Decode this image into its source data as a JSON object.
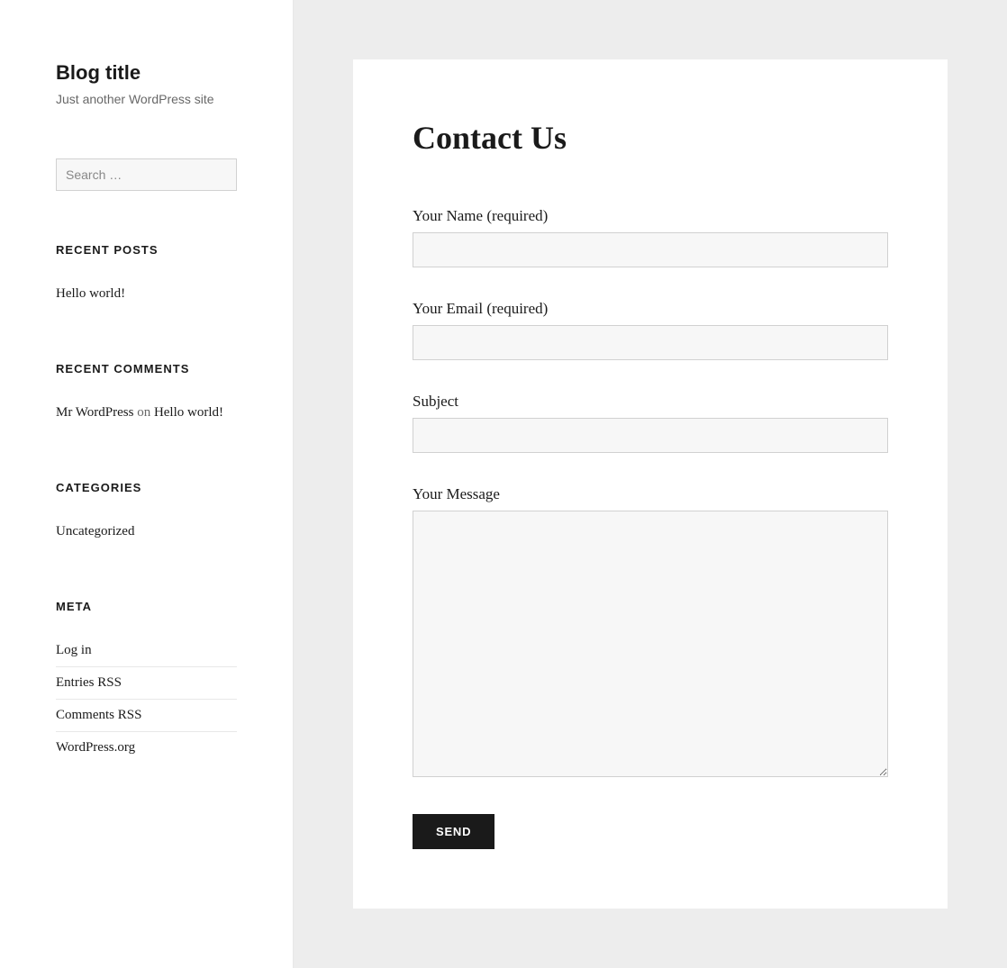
{
  "sidebar": {
    "site_title": "Blog title",
    "tagline": "Just another WordPress site",
    "search": {
      "placeholder": "Search …"
    },
    "recent_posts": {
      "heading": "RECENT POSTS",
      "items": [
        "Hello world!"
      ]
    },
    "recent_comments": {
      "heading": "RECENT COMMENTS",
      "items": [
        {
          "author": "Mr WordPress",
          "connector": " on ",
          "post": "Hello world!"
        }
      ]
    },
    "categories": {
      "heading": "CATEGORIES",
      "items": [
        "Uncategorized"
      ]
    },
    "meta": {
      "heading": "META",
      "items": [
        "Log in",
        "Entries RSS",
        "Comments RSS",
        "WordPress.org"
      ]
    }
  },
  "main": {
    "page_title": "Contact Us",
    "form": {
      "name_label": "Your Name (required)",
      "email_label": "Your Email (required)",
      "subject_label": "Subject",
      "message_label": "Your Message",
      "submit_label": "SEND"
    }
  }
}
